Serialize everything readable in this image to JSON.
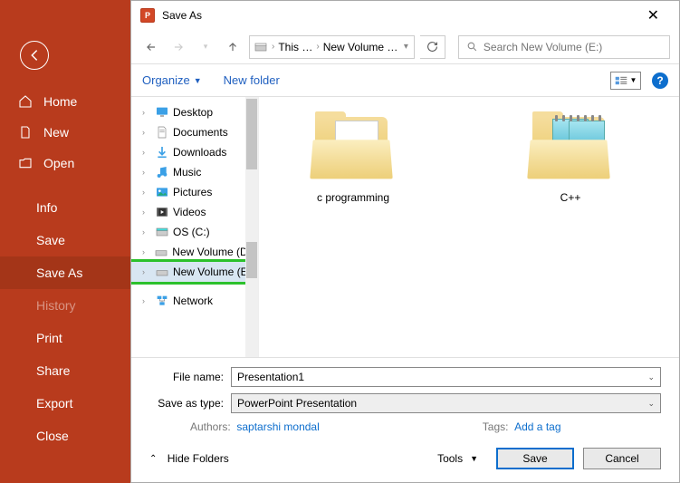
{
  "ppt_sidebar": {
    "items": [
      {
        "label": "Home"
      },
      {
        "label": "New"
      },
      {
        "label": "Open"
      }
    ],
    "sub_items": [
      {
        "label": "Info"
      },
      {
        "label": "Save"
      },
      {
        "label": "Save As"
      },
      {
        "label": "History"
      },
      {
        "label": "Print"
      },
      {
        "label": "Share"
      },
      {
        "label": "Export"
      },
      {
        "label": "Close"
      }
    ]
  },
  "dialog": {
    "title": "Save As",
    "breadcrumb": {
      "part1": "This …",
      "part2": "New Volume …"
    },
    "search_placeholder": "Search New Volume (E:)",
    "toolbar": {
      "organize": "Organize",
      "new_folder": "New folder"
    },
    "tree": [
      {
        "label": "Desktop",
        "icon": "desktop"
      },
      {
        "label": "Documents",
        "icon": "documents"
      },
      {
        "label": "Downloads",
        "icon": "downloads"
      },
      {
        "label": "Music",
        "icon": "music"
      },
      {
        "label": "Pictures",
        "icon": "pictures"
      },
      {
        "label": "Videos",
        "icon": "videos"
      },
      {
        "label": "OS (C:)",
        "icon": "drive"
      },
      {
        "label": "New Volume (D:)",
        "icon": "drive"
      },
      {
        "label": "New Volume (E:)",
        "icon": "drive",
        "highlighted": true
      },
      {
        "label": "Network",
        "icon": "network"
      }
    ],
    "folders": [
      {
        "name": "c programming",
        "type": "folder-paper"
      },
      {
        "name": "C++",
        "type": "folder-notes"
      }
    ],
    "filename_label": "File name:",
    "filename_value": "Presentation1",
    "savetype_label": "Save as type:",
    "savetype_value": "PowerPoint Presentation",
    "authors_label": "Authors:",
    "authors_value": "saptarshi mondal",
    "tags_label": "Tags:",
    "tags_value": "Add a tag",
    "hide_folders": "Hide Folders",
    "tools": "Tools",
    "save": "Save",
    "cancel": "Cancel"
  }
}
